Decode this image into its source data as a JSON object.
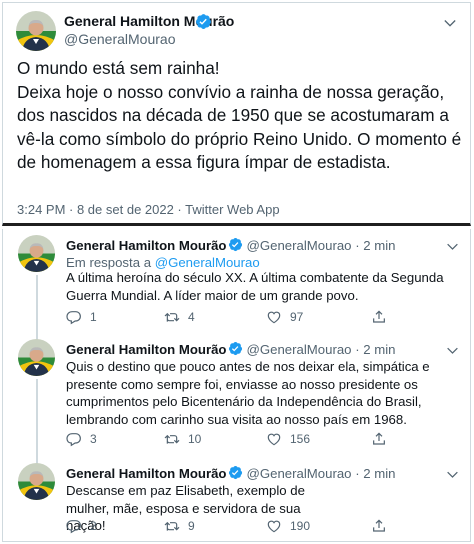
{
  "main_tweet": {
    "author_name": "General Hamilton Mourão",
    "author_handle": "@GeneralMourao",
    "text": "O mundo está sem rainha!\nDeixa hoje o nosso convívio a rainha de nossa geração, dos nascidos na década de 1950 que se acostumaram a vê-la como símbolo do próprio Reino Unido. O momento é de homenagem a essa figura ímpar de estadista.",
    "meta": "3:24 PM · 8 de set de 2022 · Twitter Web App"
  },
  "replies": [
    {
      "author_name": "General Hamilton Mourão",
      "author_handle": "@GeneralMourao",
      "time": "· 2 min",
      "reply_to_prefix": "Em resposta a ",
      "reply_to_handle": "@GeneralMourao",
      "text": "A última heroína do século XX. A última combatente da Segunda Guerra Mundial. A líder maior de um grande povo.",
      "replies_count": "1",
      "retweets_count": "4",
      "likes_count": "97"
    },
    {
      "author_name": "General Hamilton Mourão",
      "author_handle": "@GeneralMourao",
      "time": "· 2 min",
      "text": "Quis o destino que pouco antes de nos deixar ela, simpática e presente como sempre foi, enviasse ao nosso presidente os cumprimentos pelo Bicentenário da Independência do Brasil, lembrando com carinho sua visita ao nosso país em 1968.",
      "replies_count": "3",
      "retweets_count": "10",
      "likes_count": "156"
    },
    {
      "author_name": "General Hamilton Mourão",
      "author_handle": "@GeneralMourao",
      "time": "· 2 min",
      "text": "Descanse em paz Elisabeth, exemplo de mulher, mãe, esposa e servidora de sua nação!",
      "replies_count": "2",
      "retweets_count": "9",
      "likes_count": "190"
    }
  ],
  "colors": {
    "verified": "#1d9bf0",
    "muted_text": "#536471",
    "link": "#1d9bf0",
    "border": "#cfd9de"
  },
  "icons": [
    "verified-badge-icon",
    "caret-down-icon",
    "reply-icon",
    "retweet-icon",
    "like-icon",
    "share-icon"
  ]
}
